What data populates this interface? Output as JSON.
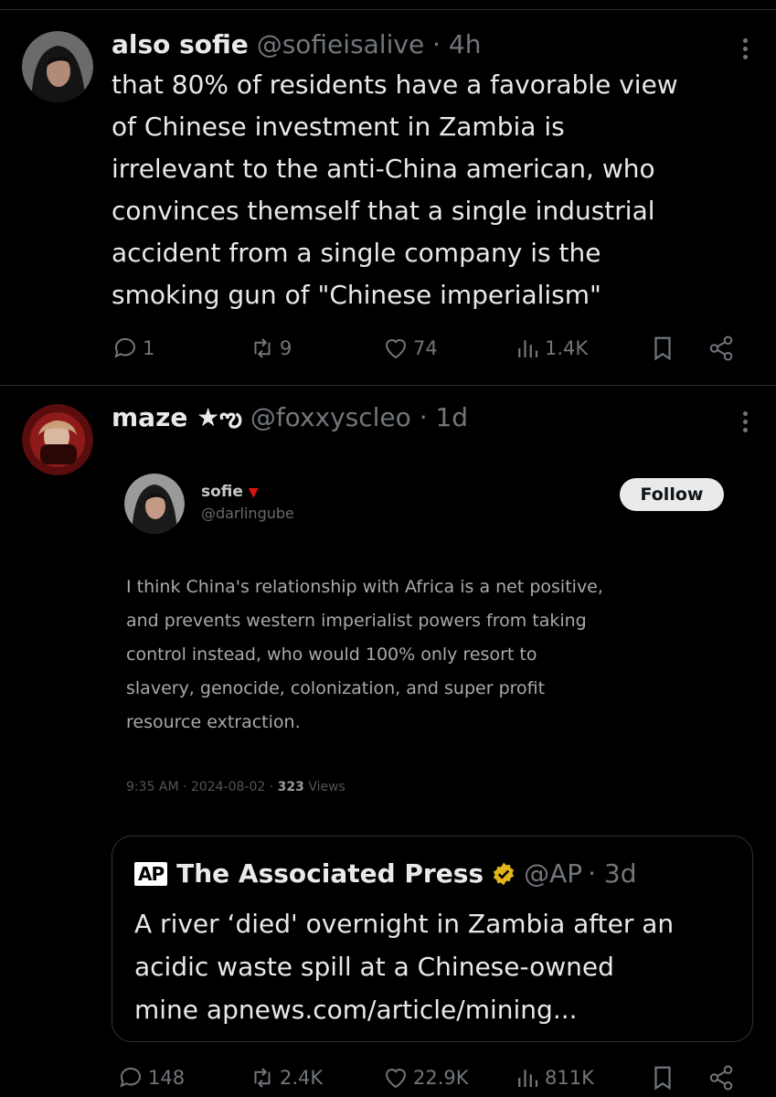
{
  "tweets": [
    {
      "name": "also sofie",
      "handle": "@sofieisalive",
      "time": "· 4h",
      "lines": [
        "that 80% of residents have a favorable view",
        "of Chinese investment in Zambia is",
        "irrelevant to the anti-China american, who",
        "convinces themself that a single industrial",
        "accident from a single company is the",
        "smoking gun of \"Chinese imperialism\""
      ],
      "replies": "1",
      "retweets": "9",
      "likes": "74",
      "views": "1.4K"
    },
    {
      "name": "maze ★ఌ",
      "handle": "@foxxyscleo",
      "time": "· 1d",
      "replies": "148",
      "retweets": "2.4K",
      "likes": "22.9K",
      "views": "811K"
    }
  ],
  "quoted_image": {
    "name": "sofie",
    "handle": "@darlingube",
    "follow_label": "Follow",
    "lines": [
      "I think China's relationship with Africa is a net positive,",
      "and prevents western imperialist powers from taking",
      "control instead, who would 100% only resort to",
      "slavery, genocide, colonization, and super profit",
      "resource extraction."
    ],
    "meta": "9:35 AM · 2024-08-02 ·",
    "views_count": "323",
    "views_label": "Views"
  },
  "quote_card": {
    "logo": "AP",
    "name": "The Associated Press",
    "handle": "@AP",
    "time": "· 3d",
    "lines": [
      "A river ‘died' overnight in Zambia after an",
      "acidic waste spill at a Chinese-owned",
      "mine apnews.com/article/mining..."
    ]
  },
  "colors": {
    "background": "#000000",
    "text": "#e7e9ea",
    "muted": "#71767b",
    "divider": "#2f3336",
    "verified_gold": "#e2b719"
  },
  "icons": [
    "reply-icon",
    "retweet-icon",
    "like-icon",
    "views-icon",
    "bookmark-icon",
    "share-icon",
    "more-icon",
    "verified-badge-icon"
  ]
}
